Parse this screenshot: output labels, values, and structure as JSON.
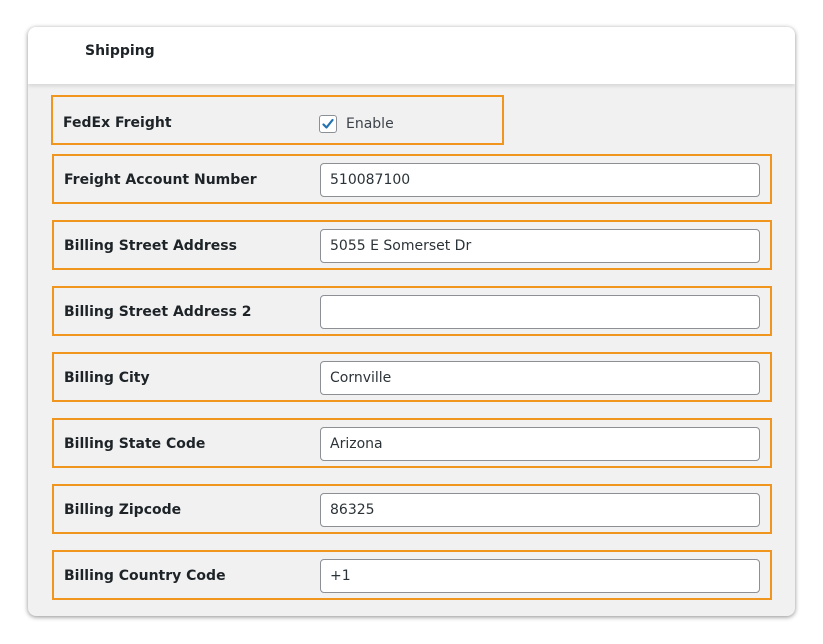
{
  "header": {
    "title": "Shipping"
  },
  "fedex_freight": {
    "label": "FedEx Freight",
    "checkbox_label": "Enable",
    "checked": true
  },
  "fields": [
    {
      "label": "Freight Account Number",
      "value": "510087100"
    },
    {
      "label": "Billing Street Address",
      "value": "5055 E Somerset Dr"
    },
    {
      "label": "Billing Street Address 2",
      "value": ""
    },
    {
      "label": "Billing City",
      "value": "Cornville"
    },
    {
      "label": "Billing State Code",
      "value": "Arizona"
    },
    {
      "label": "Billing Zipcode",
      "value": "86325"
    },
    {
      "label": "Billing Country Code",
      "value": "+1"
    }
  ],
  "colors": {
    "highlight_border": "#f0961e",
    "checkbox_check": "#2271b1"
  }
}
